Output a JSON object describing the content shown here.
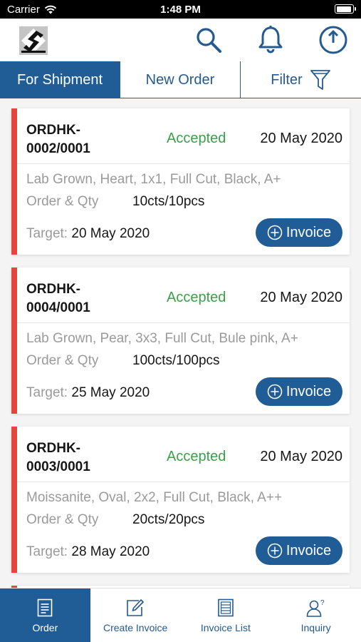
{
  "status_bar": {
    "carrier": "Carrier",
    "time": "1:48 PM",
    "icons": [
      "wifi-icon",
      "battery-icon"
    ]
  },
  "header": {
    "logo": "company-logo",
    "icons": [
      "search-icon",
      "bell-icon",
      "power-icon"
    ]
  },
  "tabs": [
    {
      "label": "For Shipment",
      "active": true
    },
    {
      "label": "New Order",
      "active": false
    },
    {
      "label": "Filter",
      "active": false,
      "icon": "filter-icon"
    }
  ],
  "orders": [
    {
      "order_id": "ORDHK-0002/0001",
      "order_id_line1": "ORDHK-",
      "order_id_line2": "0002/0001",
      "status": "Accepted",
      "date": "20 May 2020",
      "description": "Lab Grown, Heart, 1x1, Full Cut, Black, A+",
      "qty_label": "Order & Qty",
      "qty_value": "10cts/10pcs",
      "target_label": "Target:",
      "target_date": "20 May 2020",
      "button_label": "Invoice"
    },
    {
      "order_id": "ORDHK-0004/0001",
      "order_id_line1": "ORDHK-",
      "order_id_line2": "0004/0001",
      "status": "Accepted",
      "date": "20 May 2020",
      "description": "Lab Grown, Pear, 3x3, Full Cut, Bule pink, A+",
      "qty_label": "Order & Qty",
      "qty_value": "100cts/100pcs",
      "target_label": "Target:",
      "target_date": "25 May 2020",
      "button_label": "Invoice"
    },
    {
      "order_id": "ORDHK-0003/0001",
      "order_id_line1": "ORDHK-",
      "order_id_line2": "0003/0001",
      "status": "Accepted",
      "date": "20 May 2020",
      "description": "Moissanite, Oval, 2x2, Full Cut, Black, A++",
      "qty_label": "Order & Qty",
      "qty_value": "20cts/20pcs",
      "target_label": "Target:",
      "target_date": "28 May 2020",
      "button_label": "Invoice"
    }
  ],
  "bottom_nav": [
    {
      "label": "Order",
      "icon": "order-icon",
      "active": true
    },
    {
      "label": "Create Invoice",
      "icon": "create-invoice-icon",
      "active": false
    },
    {
      "label": "Invoice List",
      "icon": "invoice-list-icon",
      "active": false
    },
    {
      "label": "Inquiry",
      "icon": "inquiry-icon",
      "active": false
    }
  ],
  "colors": {
    "primary": "#205c96",
    "accepted": "#3aa047",
    "card_accent": "#e5453d"
  }
}
